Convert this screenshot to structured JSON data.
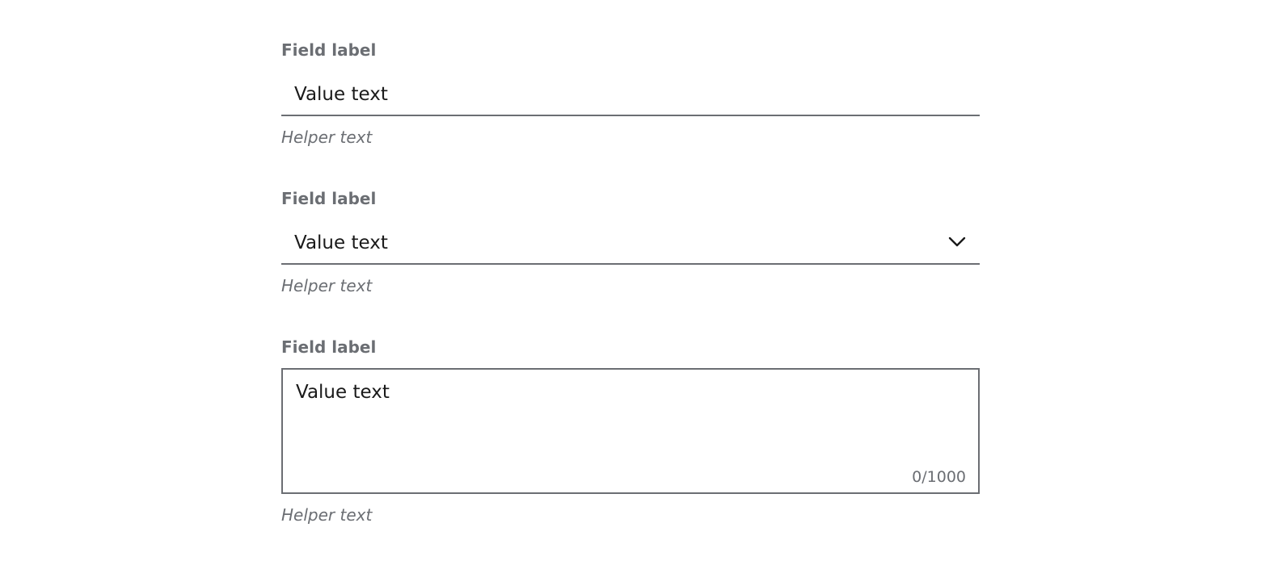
{
  "fields": [
    {
      "type": "text-input",
      "label": "Field label",
      "value": "Value text",
      "helper": "Helper text"
    },
    {
      "type": "select",
      "label": "Field label",
      "value": "Value text",
      "helper": "Helper text",
      "icon": "chevron-down-icon"
    },
    {
      "type": "textarea",
      "label": "Field label",
      "value": "Value text",
      "counter": "0/1000",
      "helper": "Helper text"
    }
  ],
  "colors": {
    "label": "#6b6e73",
    "value": "#1a1a1a",
    "border": "#6b6e73"
  }
}
